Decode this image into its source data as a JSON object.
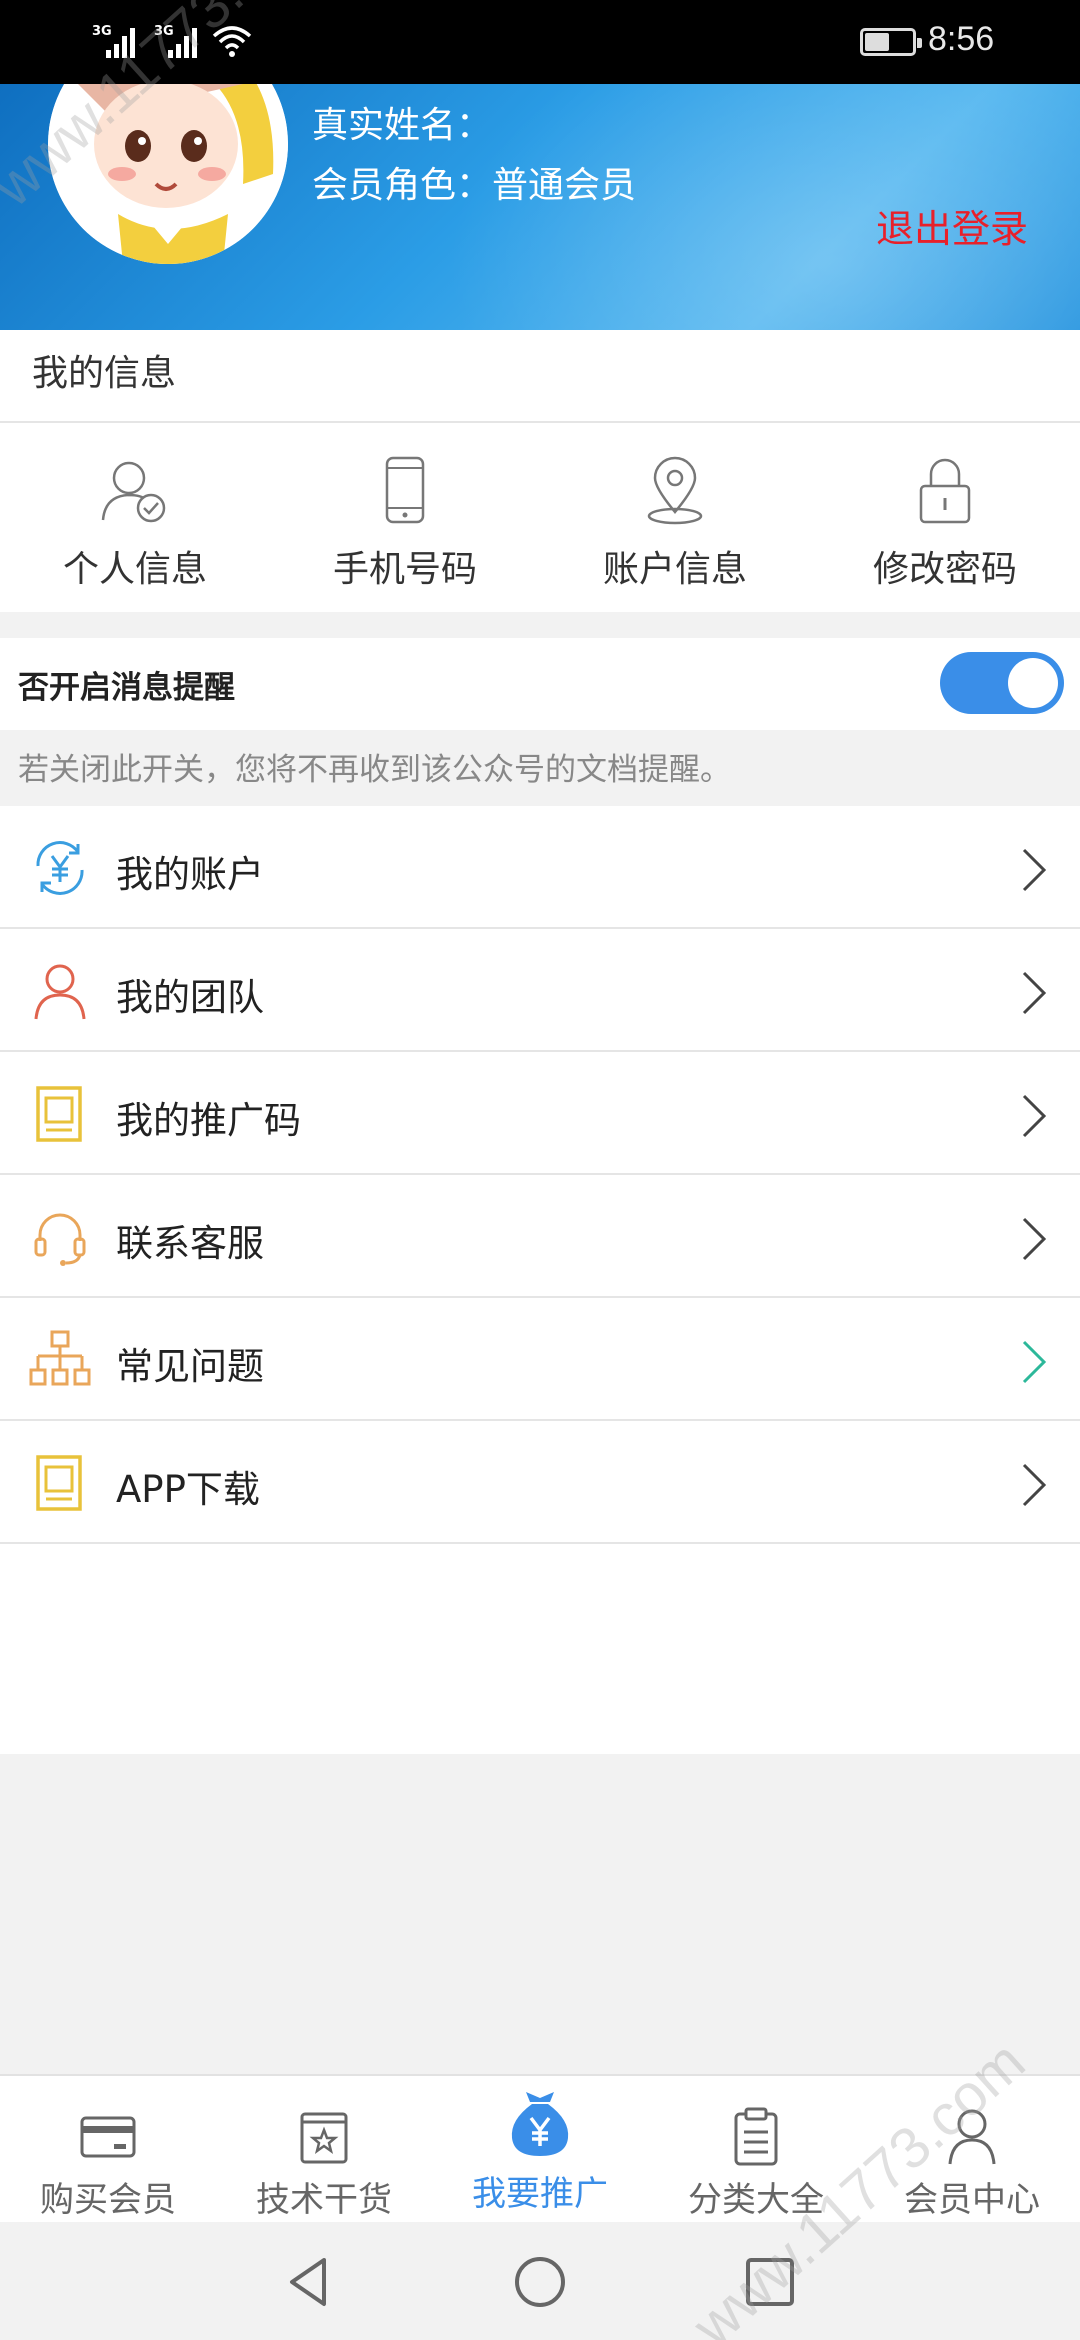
{
  "status_bar": {
    "signal_1_label": "3G",
    "signal_2_label": "3G",
    "time": "8:56"
  },
  "profile": {
    "real_name_label": "真实姓名：",
    "role_label": "会员角色：普通会员",
    "logout_label": "退出登录"
  },
  "my_info": {
    "title": "我的信息",
    "items": [
      {
        "label": "个人信息",
        "icon": "user-check-icon"
      },
      {
        "label": "手机号码",
        "icon": "phone-icon"
      },
      {
        "label": "账户信息",
        "icon": "location-pin-icon"
      },
      {
        "label": "修改密码",
        "icon": "lock-icon"
      }
    ]
  },
  "notification": {
    "label": "否开启消息提醒",
    "enabled": true,
    "hint": "若关闭此开关，您将不再收到该公众号的文档提醒。"
  },
  "menu": {
    "items": [
      {
        "label": "我的账户",
        "icon": "yuan-refresh-icon"
      },
      {
        "label": "我的团队",
        "icon": "person-icon"
      },
      {
        "label": "我的推广码",
        "icon": "document-icon"
      },
      {
        "label": "联系客服",
        "icon": "headset-icon"
      },
      {
        "label": "常见问题",
        "icon": "org-chart-icon"
      },
      {
        "label": "APP下载",
        "icon": "document-icon"
      }
    ]
  },
  "bottom_nav": {
    "items": [
      {
        "label": "购买会员",
        "icon": "card-icon"
      },
      {
        "label": "技术干货",
        "icon": "star-book-icon"
      },
      {
        "label": "我要推广",
        "icon": "money-bag-icon",
        "active": true
      },
      {
        "label": "分类大全",
        "icon": "clipboard-icon"
      },
      {
        "label": "会员中心",
        "icon": "user-icon"
      }
    ]
  },
  "watermark": {
    "text_1": "www.11773.com",
    "text_2": "www.11773.com"
  },
  "colors": {
    "header_blue": "#2b9de6",
    "accent_blue": "#3a8ee8",
    "logout_red": "#e8202a",
    "icon_orange": "#e9a65a",
    "icon_yellow": "#e8c23a",
    "icon_red": "#e0644e"
  }
}
